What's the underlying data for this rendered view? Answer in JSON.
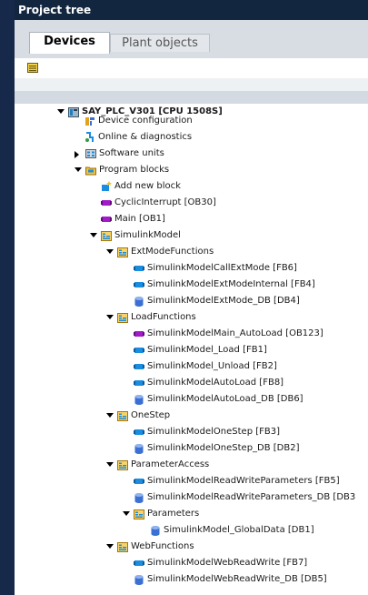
{
  "panel_title": "Project tree",
  "tabs": [
    {
      "label": "Devices"
    },
    {
      "label": "Plant objects"
    }
  ],
  "tree": [
    {
      "label": "SAY_PLC_V301 [CPU 1508S]",
      "icon": "plc-icon",
      "expander": "open"
    },
    {
      "label": "Device configuration",
      "icon": "device-config-icon",
      "expander": "none"
    },
    {
      "label": "Online & diagnostics",
      "icon": "online-diagnostics-icon",
      "expander": "none"
    },
    {
      "label": "Software units",
      "icon": "software-units-icon",
      "expander": "closed"
    },
    {
      "label": "Program blocks",
      "icon": "program-blocks-folder-icon",
      "expander": "open"
    },
    {
      "label": "Add new block",
      "icon": "add-block-icon",
      "expander": "none"
    },
    {
      "label": "CyclicInterrupt [OB30]",
      "icon": "ob-block-icon",
      "expander": "none"
    },
    {
      "label": "Main [OB1]",
      "icon": "ob-block-icon",
      "expander": "none"
    },
    {
      "label": "SimulinkModel",
      "icon": "group-folder-icon",
      "expander": "open"
    },
    {
      "label": "ExtModeFunctions",
      "icon": "group-folder-icon",
      "expander": "open"
    },
    {
      "label": "SimulinkModelCallExtMode [FB6]",
      "icon": "fb-block-icon",
      "expander": "none"
    },
    {
      "label": "SimulinkModelExtModeInternal [FB4]",
      "icon": "fb-block-icon",
      "expander": "none"
    },
    {
      "label": "SimulinkModelExtMode_DB [DB4]",
      "icon": "db-block-icon",
      "expander": "none"
    },
    {
      "label": "LoadFunctions",
      "icon": "group-folder-icon",
      "expander": "open"
    },
    {
      "label": "SimulinkModelMain_AutoLoad [OB123]",
      "icon": "ob-block-icon",
      "expander": "none"
    },
    {
      "label": "SimulinkModel_Load [FB1]",
      "icon": "fb-block-icon",
      "expander": "none"
    },
    {
      "label": "SimulinkModel_Unload [FB2]",
      "icon": "fb-block-icon",
      "expander": "none"
    },
    {
      "label": "SimulinkModelAutoLoad [FB8]",
      "icon": "fb-block-icon",
      "expander": "none"
    },
    {
      "label": "SimulinkModelAutoLoad_DB [DB6]",
      "icon": "db-block-icon",
      "expander": "none"
    },
    {
      "label": "OneStep",
      "icon": "group-folder-icon",
      "expander": "open"
    },
    {
      "label": "SimulinkModelOneStep [FB3]",
      "icon": "fb-block-icon",
      "expander": "none"
    },
    {
      "label": "SimulinkModelOneStep_DB [DB2]",
      "icon": "db-block-icon",
      "expander": "none"
    },
    {
      "label": "ParameterAccess",
      "icon": "group-folder-icon",
      "expander": "open"
    },
    {
      "label": "SimulinkModelReadWriteParameters [FB5]",
      "icon": "fb-block-icon",
      "expander": "none"
    },
    {
      "label": "SimulinkModelReadWriteParameters_DB [DB3",
      "icon": "db-block-icon",
      "expander": "none"
    },
    {
      "label": "Parameters",
      "icon": "group-folder-icon",
      "expander": "open"
    },
    {
      "label": "SimulinkModel_GlobalData [DB1]",
      "icon": "db-block-icon",
      "expander": "none"
    },
    {
      "label": "WebFunctions",
      "icon": "group-folder-icon",
      "expander": "open"
    },
    {
      "label": "SimulinkModelWebReadWrite [FB7]",
      "icon": "fb-block-icon",
      "expander": "none"
    },
    {
      "label": "SimulinkModelWebReadWrite_DB [DB5]",
      "icon": "db-block-icon",
      "expander": "none"
    }
  ],
  "colors": {
    "title_bar": "#122640",
    "ob_block": "#a21bc8",
    "fb_block": "#1b8de0",
    "db_block": "#3b6fd4",
    "folder": "#e2a21b"
  }
}
